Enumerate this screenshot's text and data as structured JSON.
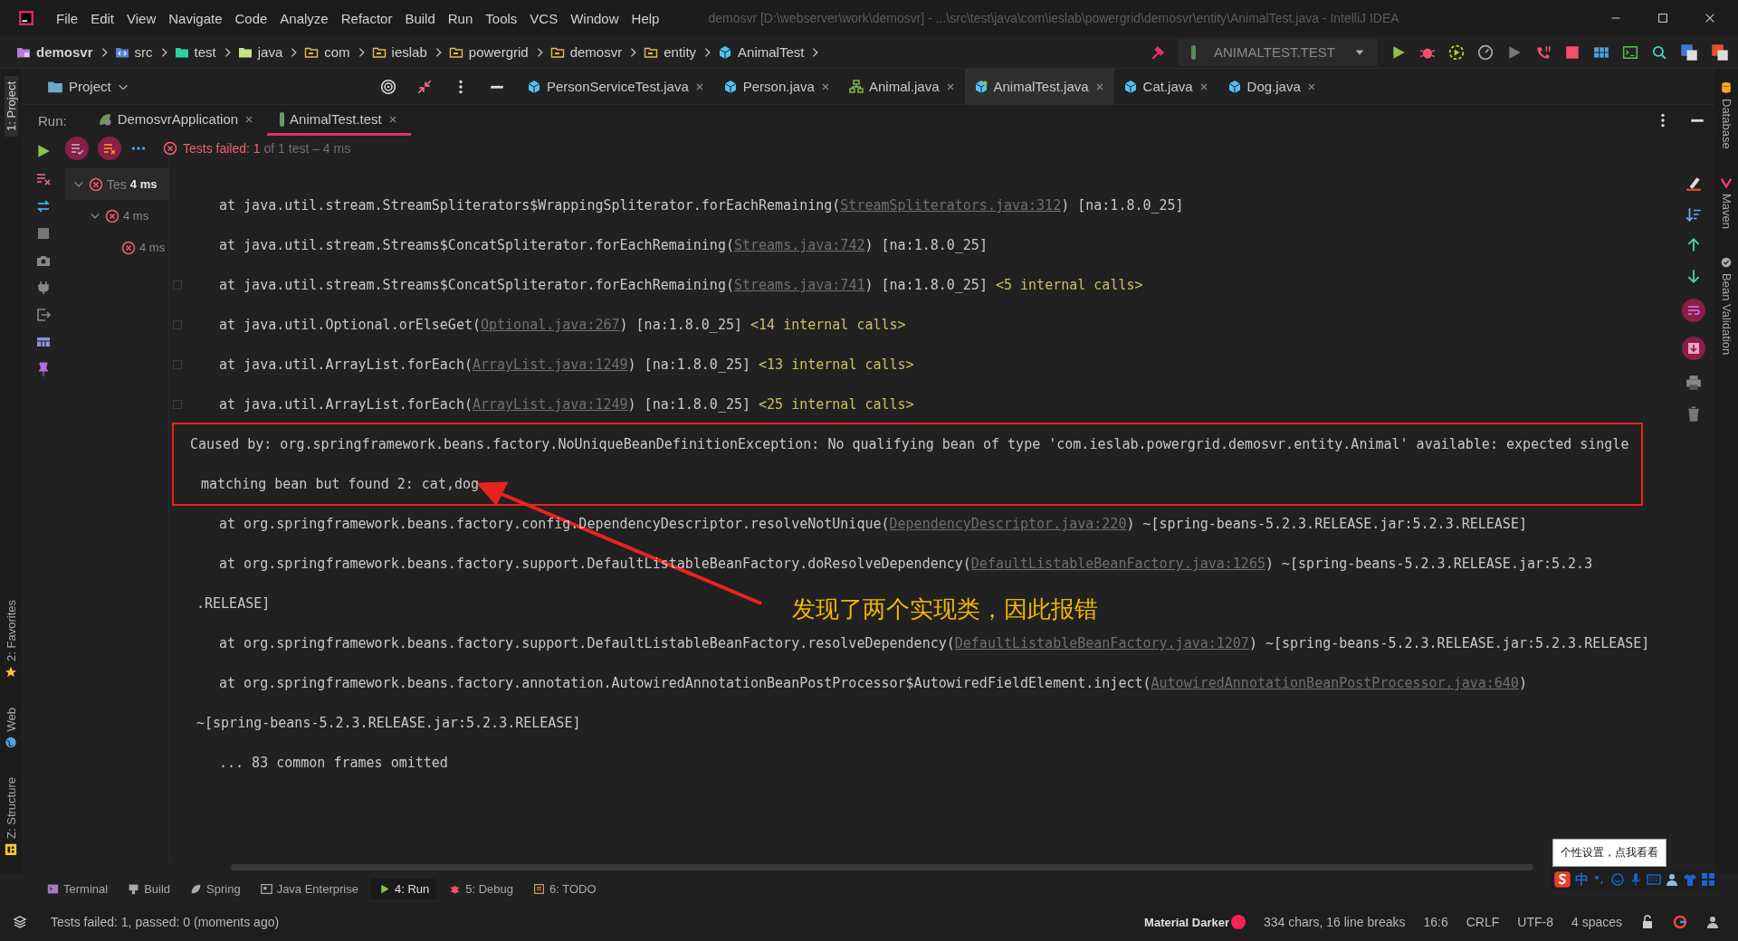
{
  "menu": [
    "File",
    "Edit",
    "View",
    "Navigate",
    "Code",
    "Analyze",
    "Refactor",
    "Build",
    "Run",
    "Tools",
    "VCS",
    "Window",
    "Help"
  ],
  "window_title": "demosvr [D:\\webserver\\work\\demosvr] - ...\\src\\test\\java\\com\\ieslab\\powergrid\\demosvr\\entity\\AnimalTest.java - IntelliJ IDEA",
  "breadcrumbs": [
    {
      "label": "demosvr",
      "kind": "module"
    },
    {
      "label": "src",
      "kind": "source"
    },
    {
      "label": "test",
      "kind": "test"
    },
    {
      "label": "java",
      "kind": "java"
    },
    {
      "label": "com",
      "kind": "package"
    },
    {
      "label": "ieslab",
      "kind": "package"
    },
    {
      "label": "powergrid",
      "kind": "package"
    },
    {
      "label": "demosvr",
      "kind": "package"
    },
    {
      "label": "entity",
      "kind": "package"
    },
    {
      "label": "AnimalTest",
      "kind": "class"
    }
  ],
  "run_config": "ANIMALTEST.TEST",
  "project_panel": {
    "label": "Project"
  },
  "editor_tabs": [
    {
      "label": "PersonServiceTest.java",
      "kind": "class",
      "selected": false
    },
    {
      "label": "Person.java",
      "kind": "class",
      "selected": false
    },
    {
      "label": "Animal.java",
      "kind": "hierarchy",
      "selected": false
    },
    {
      "label": "AnimalTest.java",
      "kind": "test",
      "selected": true
    },
    {
      "label": "Cat.java",
      "kind": "class",
      "selected": false
    },
    {
      "label": "Dog.java",
      "kind": "class",
      "selected": false
    }
  ],
  "run_label": "Run:",
  "run_tabs": [
    {
      "label": "DemosvrApplication",
      "kind": "spring",
      "selected": false
    },
    {
      "label": "AnimalTest.test",
      "kind": "test",
      "selected": true
    }
  ],
  "test_status": {
    "failed": "Tests failed: 1",
    "rest": "of 1 test – 4 ms"
  },
  "test_tree": [
    {
      "label": "Tes",
      "time": "4 ms",
      "selected": true,
      "expanded": true,
      "children": [
        {
          "time": "4 ms",
          "selected": false,
          "expanded": true,
          "children": [
            {
              "time": "4 ms",
              "selected": false
            }
          ]
        }
      ]
    }
  ],
  "console": {
    "lines": [
      {
        "kind": "frame",
        "foldable": false,
        "highlighted": false,
        "segments": [
          {
            "kind": "text",
            "text": "at java.util.stream.StreamSpliterators$WrappingSpliterator.forEachRemaining("
          },
          {
            "kind": "link",
            "text": "StreamSpliterators.java:312"
          },
          {
            "kind": "text",
            "text": ") [na:1.8.0_25]"
          }
        ]
      },
      {
        "kind": "frame",
        "foldable": false,
        "highlighted": false,
        "segments": [
          {
            "kind": "text",
            "text": "at java.util.stream.Streams$ConcatSpliterator.forEachRemaining("
          },
          {
            "kind": "link",
            "text": "Streams.java:742"
          },
          {
            "kind": "text",
            "text": ") [na:1.8.0_25]"
          }
        ]
      },
      {
        "kind": "frame",
        "foldable": true,
        "highlighted": false,
        "segments": [
          {
            "kind": "text",
            "text": "at java.util.stream.Streams$ConcatSpliterator.forEachRemaining("
          },
          {
            "kind": "link",
            "text": "Streams.java:741"
          },
          {
            "kind": "text",
            "text": ") [na:1.8.0_25] "
          },
          {
            "kind": "internal",
            "text": "<5 internal calls>"
          }
        ]
      },
      {
        "kind": "frame",
        "foldable": true,
        "highlighted": false,
        "segments": [
          {
            "kind": "text",
            "text": "at java.util.Optional.orElseGet("
          },
          {
            "kind": "link",
            "text": "Optional.java:267"
          },
          {
            "kind": "text",
            "text": ") [na:1.8.0_25] "
          },
          {
            "kind": "internal",
            "text": "<14 internal calls>"
          }
        ]
      },
      {
        "kind": "frame",
        "foldable": true,
        "highlighted": false,
        "segments": [
          {
            "kind": "text",
            "text": "at java.util.ArrayList.forEach("
          },
          {
            "kind": "link",
            "text": "ArrayList.java:1249"
          },
          {
            "kind": "text",
            "text": ") [na:1.8.0_25] "
          },
          {
            "kind": "internal",
            "text": "<13 internal calls>"
          }
        ]
      },
      {
        "kind": "frame",
        "foldable": true,
        "highlighted": false,
        "segments": [
          {
            "kind": "text",
            "text": "at java.util.ArrayList.forEach("
          },
          {
            "kind": "link",
            "text": "ArrayList.java:1249"
          },
          {
            "kind": "text",
            "text": ") [na:1.8.0_25] "
          },
          {
            "kind": "internal",
            "text": "<25 internal calls>"
          }
        ]
      },
      {
        "kind": "cause",
        "foldable": false,
        "highlighted": true,
        "segments": [
          {
            "kind": "text",
            "text": "Caused by: org.springframework.beans.factory.NoUniqueBeanDefinitionException: No qualifying bean of type 'com.ieslab.powergrid.demosvr.entity.Animal' available: expected single"
          }
        ]
      },
      {
        "kind": "wrap",
        "foldable": false,
        "highlighted": true,
        "segments": [
          {
            "kind": "text",
            "text": "matching bean but found 2: cat,dog"
          }
        ]
      },
      {
        "kind": "frame",
        "foldable": false,
        "highlighted": false,
        "segments": [
          {
            "kind": "text",
            "text": "at org.springframework.beans.factory.config.DependencyDescriptor.resolveNotUnique("
          },
          {
            "kind": "link",
            "text": "DependencyDescriptor.java:220"
          },
          {
            "kind": "text",
            "text": ") ~[spring-beans-5.2.3.RELEASE.jar:5.2.3.RELEASE]"
          }
        ]
      },
      {
        "kind": "frame",
        "foldable": false,
        "highlighted": false,
        "segments": [
          {
            "kind": "text",
            "text": "at org.springframework.beans.factory.support.DefaultListableBeanFactory.doResolveDependency("
          },
          {
            "kind": "link",
            "text": "DefaultListableBeanFactory.java:1265"
          },
          {
            "kind": "text",
            "text": ") ~[spring-beans-5.2.3.RELEASE.jar:5.2.3"
          }
        ]
      },
      {
        "kind": "wrap",
        "foldable": false,
        "highlighted": false,
        "segments": [
          {
            "kind": "text",
            "text": ".RELEASE]"
          }
        ]
      },
      {
        "kind": "frame",
        "foldable": false,
        "highlighted": false,
        "segments": [
          {
            "kind": "text",
            "text": "at org.springframework.beans.factory.support.DefaultListableBeanFactory.resolveDependency("
          },
          {
            "kind": "link",
            "text": "DefaultListableBeanFactory.java:1207"
          },
          {
            "kind": "text",
            "text": ") ~[spring-beans-5.2.3.RELEASE.jar:5.2.3.RELEASE]"
          }
        ]
      },
      {
        "kind": "frame",
        "foldable": false,
        "highlighted": false,
        "segments": [
          {
            "kind": "text",
            "text": "at org.springframework.beans.factory.annotation.AutowiredAnnotationBeanPostProcessor$AutowiredFieldElement.inject("
          },
          {
            "kind": "link",
            "text": "AutowiredAnnotationBeanPostProcessor.java:640"
          },
          {
            "kind": "text",
            "text": ")"
          }
        ]
      },
      {
        "kind": "wrap",
        "foldable": false,
        "highlighted": false,
        "segments": [
          {
            "kind": "text",
            "text": "~[spring-beans-5.2.3.RELEASE.jar:5.2.3.RELEASE]"
          }
        ]
      },
      {
        "kind": "frame",
        "foldable": false,
        "highlighted": false,
        "segments": [
          {
            "kind": "text",
            "text": "... 83 common frames omitted"
          }
        ]
      }
    ],
    "annotation": "发现了两个实现类，因此报错"
  },
  "left_stripe_top": [
    {
      "label": "1: Project",
      "selected": true
    }
  ],
  "left_stripe_bottom": [
    {
      "label": "2: Favorites",
      "kind": "star",
      "selected": false
    },
    {
      "label": "Web",
      "kind": "globe",
      "selected": false
    },
    {
      "label": "Z: Structure",
      "kind": "structure",
      "selected": false
    }
  ],
  "right_stripe": [
    {
      "label": "Database",
      "kind": "database",
      "selected": false
    },
    {
      "label": "Maven",
      "kind": "maven",
      "selected": false
    },
    {
      "label": "Bean Validation",
      "kind": "bean",
      "selected": false
    }
  ],
  "bottom_tabs": [
    {
      "label": "Terminal",
      "kind": "terminal",
      "selected": false
    },
    {
      "label": "Build",
      "kind": "build",
      "selected": false
    },
    {
      "label": "Spring",
      "kind": "spring",
      "selected": false
    },
    {
      "label": "Java Enterprise",
      "kind": "enterprise",
      "selected": false
    },
    {
      "label": "4: Run",
      "kind": "run",
      "selected": true
    },
    {
      "label": "5: Debug",
      "kind": "debug",
      "selected": false
    },
    {
      "label": "6: TODO",
      "kind": "todo",
      "selected": false
    }
  ],
  "status_bar": {
    "message": "Tests failed: 1, passed: 0 (moments ago)",
    "theme": "Material Darker",
    "stats": "334 chars, 16 line breaks",
    "position": "16:6",
    "line_ending": "CRLF",
    "encoding": "UTF-8",
    "indent": "4 spaces"
  },
  "ime": {
    "tooltip": "个性设置，点我看看",
    "mode": "中"
  }
}
